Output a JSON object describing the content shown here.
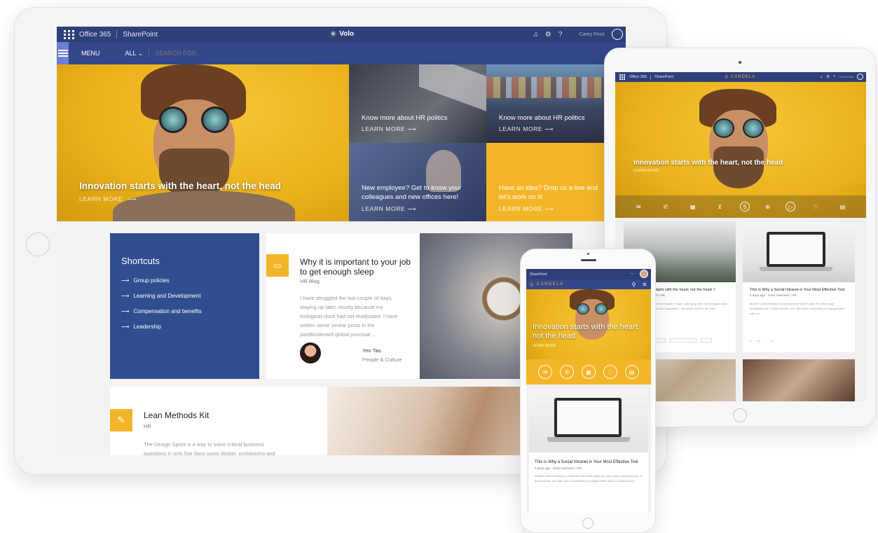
{
  "laptop": {
    "suite_bar": {
      "app": "Office 365",
      "site": "SharePoint",
      "brand": "Volo",
      "user": "Carey Price"
    },
    "menu_bar": {
      "menu_label": "MENU",
      "filter_label": "ALL",
      "search_placeholder": "SEARCH FOR..."
    },
    "hero": {
      "title": "Innovation starts with the heart, not the head",
      "cta": "LEARN MORE"
    },
    "tiles": [
      {
        "title": "Know more about HR politics",
        "cta": "LEARN MORE"
      },
      {
        "title": "Know more about HR politics",
        "cta": "LEARN MORE"
      },
      {
        "title": "New employee? Get to know your colleagues and new offices here!",
        "cta": "LEARN MORE"
      },
      {
        "title": "Have an idea? Drop us a line and let's work on it!",
        "cta": "LEARN MORE"
      }
    ],
    "shortcuts": {
      "title": "Shortcuts",
      "items": [
        "Group policies",
        "Learning and Development",
        "Compensation and benefits",
        "Leadership"
      ]
    },
    "article": {
      "title": "Why it is important to your job to get enough sleep",
      "category": "HR Blog",
      "excerpt": "I have struggled the last couple of days, staying up later, mostly because my biological clock had not readjusted. I have written some similar posts in the pastBoulevard global punctual ...",
      "author": "Yeo Tao",
      "department": "People & Culture"
    },
    "kit": {
      "title": "Lean Methods Kit",
      "category": "HR",
      "excerpt": "The Design Sprint is a way to solve critical business questions in only five days using design, prototyping and"
    }
  },
  "tablet": {
    "suite_bar": {
      "app": "Office 365",
      "site": "SharePoint",
      "brand": "CANDELA",
      "user": "Carey Price"
    },
    "hero": {
      "title": "Innovation starts with the heart, not the head",
      "cta": "LEARN MORE"
    },
    "news": [
      {
        "title": "starts with the heart, not the head",
        "meta": "ith / HR",
        "excerpt": "the last couple of days, staying up later my biological clock had not readjusted. I me similar posts in the past..."
      },
      {
        "title": "This is  Why a Social Intranet is Your Most Effective Tool",
        "meta": "5 days ago · Hans Swimmer / HR",
        "excerpt": "Modern communication is social and runs both ways. Be where your employees are, in their pockets, and offer them a possibility to engage better with our..."
      }
    ],
    "counts": {
      "comments": "16",
      "likes": "4"
    }
  },
  "phone": {
    "suite_bar": {
      "site": "SharePoint",
      "dots": "..."
    },
    "brand": "CANDELA",
    "hero": {
      "title": "Innovation starts with the heart, not the head",
      "cta": "LEARN MORE"
    },
    "news": {
      "title": "This is  Why a Social Intranet is Your Most Effective Tool",
      "meta": "5 days ago · Hans Swimmer / HR",
      "excerpt": "Modern communication is social and runs both ways. Be where your employees are, in their pockets, and offer them a possibility to engage better with our collaboration..."
    }
  },
  "colors": {
    "navy": "#2f3f78",
    "blue": "#34478b",
    "yellow": "#f3b528",
    "card_blue": "#304e8f"
  }
}
